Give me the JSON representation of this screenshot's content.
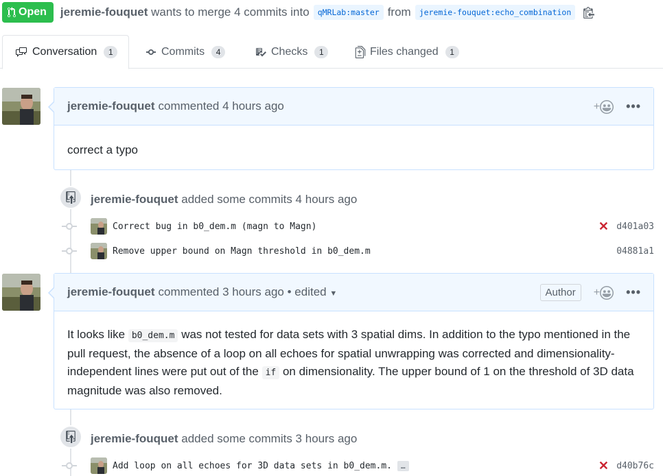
{
  "header": {
    "state": "Open",
    "author": "jeremie-fouquet",
    "merge_text": "wants to merge 4 commits into",
    "base_branch": "qMRLab:master",
    "from_text": "from",
    "head_branch": "jeremie-fouquet:echo_combination"
  },
  "tabs": [
    {
      "label": "Conversation",
      "count": "1",
      "icon": "comment-discussion-icon"
    },
    {
      "label": "Commits",
      "count": "4",
      "icon": "git-commit-icon"
    },
    {
      "label": "Checks",
      "count": "1",
      "icon": "checklist-icon"
    },
    {
      "label": "Files changed",
      "count": "1",
      "icon": "file-diff-icon"
    }
  ],
  "comment1": {
    "author": "jeremie-fouquet",
    "action": "commented",
    "time": "4 hours ago",
    "body": "correct a typo"
  },
  "event1": {
    "author": "jeremie-fouquet",
    "text": "added some commits 4 hours ago",
    "commits": [
      {
        "message": "Correct bug in b0_dem.m (magn to Magn)",
        "sha": "d401a03",
        "status": "failure"
      },
      {
        "message": "Remove upper bound on Magn threshold in b0_dem.m",
        "sha": "04881a1",
        "status": "none"
      }
    ]
  },
  "comment2": {
    "author": "jeremie-fouquet",
    "action": "commented",
    "time": "3 hours ago",
    "edited": "• edited",
    "badge": "Author",
    "body_part1": "It looks like",
    "code1": "b0_dem.m",
    "body_part2": "was not tested for data sets with 3 spatial dims. In addition to the typo mentioned in the pull request, the absence of a loop on all echoes for spatial unwrapping was corrected and dimensionality-independent lines were put out of the",
    "code2": "if",
    "body_part3": "on dimensionality. The upper bound of 1 on the threshold of 3D data magnitude was also removed."
  },
  "event2": {
    "author": "jeremie-fouquet",
    "text": "added some commits 3 hours ago",
    "commits": [
      {
        "message": "Add loop on all echoes for 3D data sets in b0_dem.m.",
        "ellipsis": "…",
        "sha": "d40b76c",
        "status": "failure"
      }
    ]
  },
  "colors": {
    "open_green": "#2cbe4e",
    "link_blue": "#0366d6",
    "failure_red": "#cb2431",
    "comment_header_bg": "#f1f8ff",
    "comment_border": "#c8e1ff"
  }
}
